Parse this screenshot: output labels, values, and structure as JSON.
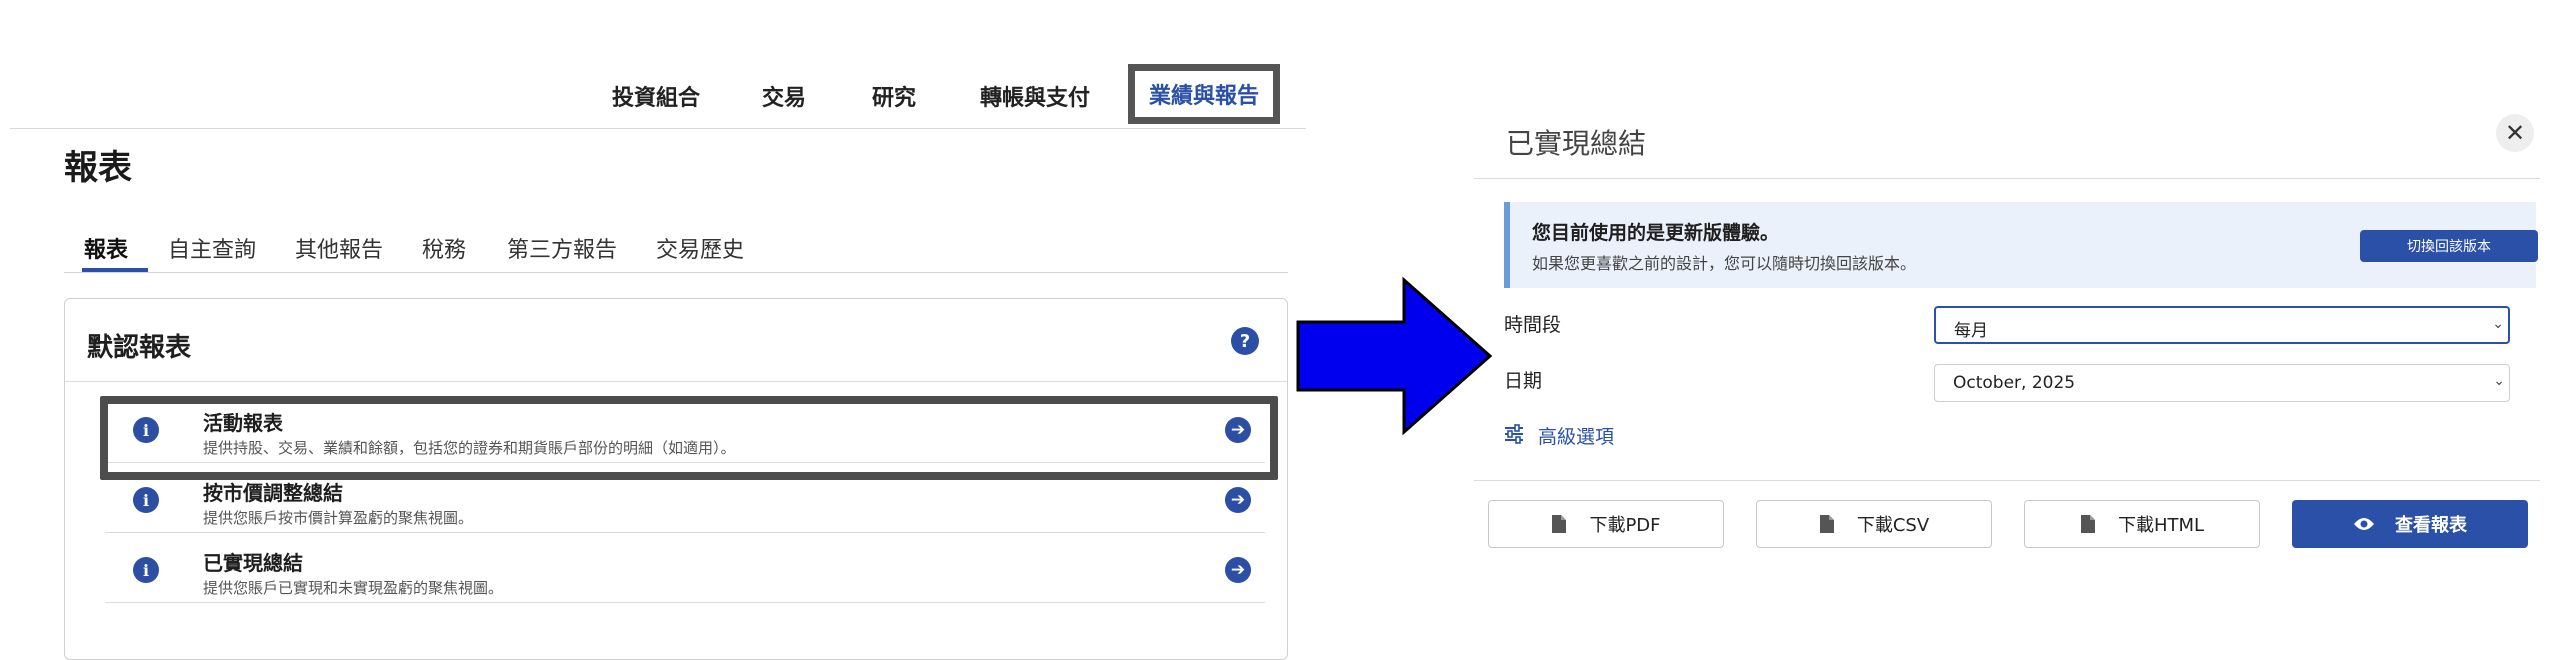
{
  "topnav": {
    "items": [
      "投資組合",
      "交易",
      "研究",
      "轉帳與支付"
    ],
    "active": "業績與報告"
  },
  "page": {
    "title": "報表"
  },
  "subtabs": [
    "報表",
    "自主查詢",
    "其他報告",
    "稅務",
    "第三方報告",
    "交易歷史"
  ],
  "card": {
    "title": "默認報表",
    "help_glyph": "?",
    "rows": [
      {
        "title": "活動報表",
        "desc": "提供持股、交易、業績和餘額，包括您的證券和期貨賬戶部份的明細（如適用）。"
      },
      {
        "title": "按市價調整總結",
        "desc": "提供您賬戶按市價計算盈虧的聚焦視圖。"
      },
      {
        "title": "已實現總結",
        "desc": "提供您賬戶已實現和未實現盈虧的聚焦視圖。"
      }
    ]
  },
  "dialog": {
    "title": "已實現總結",
    "close_glyph": "✕",
    "banner": {
      "title": "您目前使用的是更新版體驗。",
      "desc": "如果您更喜歡之前的設計，您可以隨時切換回該版本。",
      "button": "切換回該版本"
    },
    "period": {
      "label": "時間段",
      "value": "每月"
    },
    "date": {
      "label": "日期",
      "value": "October, 2025"
    },
    "advanced": "高級選項",
    "buttons": {
      "pdf": "下載PDF",
      "csv": "下載CSV",
      "html": "下載HTML",
      "view": "查看報表"
    }
  },
  "colors": {
    "brand": "#2b50a8",
    "highlight_border": "#4d4d4d",
    "arrow_fill": "#0000ee",
    "banner_bg": "#eaf1fa"
  }
}
